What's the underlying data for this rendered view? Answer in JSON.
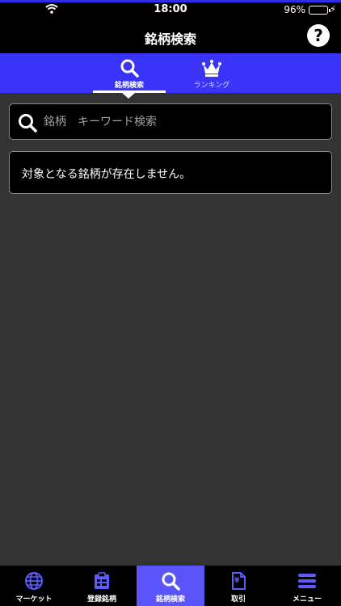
{
  "status_bar": {
    "time": "18:00",
    "battery": "96%",
    "battery_level": 0.96
  },
  "nav": {
    "title": "銘柄検索",
    "help_symbol": "?"
  },
  "tabs": [
    {
      "label": "銘柄検索",
      "icon": "search-icon",
      "active": true
    },
    {
      "label": "ランキング",
      "icon": "crown-icon",
      "active": false
    }
  ],
  "search": {
    "placeholder": "銘柄　キーワード検索",
    "value": ""
  },
  "empty_message": "対象となる銘柄が存在しません。",
  "bottom_tabs": [
    {
      "label": "マーケット",
      "icon": "globe-icon",
      "active": false
    },
    {
      "label": "登録銘柄",
      "icon": "clipboard-icon",
      "active": false
    },
    {
      "label": "銘柄検索",
      "icon": "search-icon",
      "active": true
    },
    {
      "label": "取引",
      "icon": "yen-document-icon",
      "active": false
    },
    {
      "label": "メニュー",
      "icon": "menu-icon",
      "active": false
    }
  ],
  "colors": {
    "accent": "#3a34f8",
    "active_tab": "#5a55fb",
    "background": "#333333",
    "icon_blue": "#5b5bff"
  }
}
